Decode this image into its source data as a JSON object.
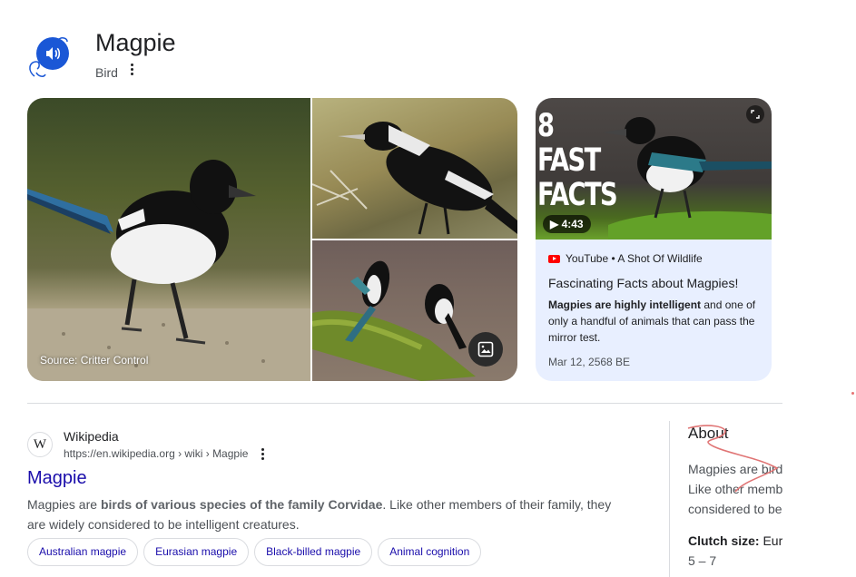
{
  "knowledge_panel": {
    "title": "Magpie",
    "subtitle": "Bird",
    "photo_source": "Source: Critter Control"
  },
  "video_card": {
    "thumbnail_text": "8\nFAST\nFACTS",
    "duration": "4:43",
    "source_line": "YouTube • A Shot Of Wildlife",
    "title": "Fascinating Facts about Magpies!",
    "desc_bold": "Magpies are highly intelligent",
    "desc_rest": " and one of only a handful of animals that can pass the mirror test.",
    "date": "Mar 12, 2568 BE"
  },
  "result": {
    "site_name": "Wikipedia",
    "url": "https://en.wikipedia.org › wiki › Magpie",
    "title": "Magpie",
    "snippet_pre": "Magpies are ",
    "snippet_bold": "birds of various species of the family Corvidae",
    "snippet_post": ". Like other members of their family, they are widely considered to be intelligent creatures.",
    "chips": [
      "Australian magpie",
      "Eurasian magpie",
      "Black-billed magpie",
      "Animal cognition"
    ]
  },
  "about": {
    "title": "About",
    "lines": [
      "Magpies are bird",
      "Like other memb",
      "considered to be"
    ],
    "fact_label": "Clutch size:",
    "fact_value_partial": " Eur",
    "fact_value": "5 – 7"
  },
  "colors": {
    "link": "#1a0dab",
    "sound_button": "#1a57d6",
    "video_card_bg": "#e8efff",
    "youtube_red": "#ff0000"
  },
  "icons": [
    "volume-icon",
    "more-vert-icon",
    "image-icon",
    "expand-icon",
    "play-icon",
    "youtube-icon",
    "wikipedia-icon"
  ]
}
